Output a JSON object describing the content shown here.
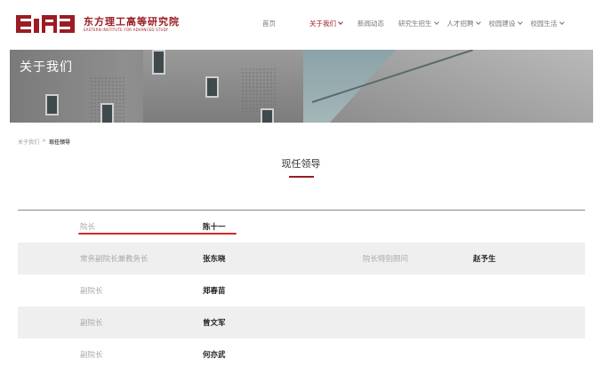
{
  "header": {
    "logo_cn": "东方理工高等研究院",
    "logo_en": "EASTERN INSTITUTE FOR ADVANCED STUDY",
    "nav": [
      {
        "label": "首页",
        "active": false,
        "has_dropdown": false
      },
      {
        "label": "关于我们",
        "active": true,
        "has_dropdown": true
      },
      {
        "label": "新闻动态",
        "active": false,
        "has_dropdown": false
      },
      {
        "label": "研究生招生",
        "active": false,
        "has_dropdown": true
      },
      {
        "label": "人才招聘",
        "active": false,
        "has_dropdown": true
      },
      {
        "label": "校园建设",
        "active": false,
        "has_dropdown": true
      },
      {
        "label": "校园生活",
        "active": false,
        "has_dropdown": true
      }
    ]
  },
  "banner": {
    "title": "关于我们"
  },
  "breadcrumb": {
    "parent": "关于我们",
    "separator": ">",
    "current": "现任领导"
  },
  "main": {
    "title": "现任领导"
  },
  "leaders": {
    "rows": [
      {
        "title": "院长",
        "name": "陈十一",
        "title2": "",
        "name2": ""
      },
      {
        "title": "常务副院长兼教务长",
        "name": "张东晓",
        "title2": "院长特别顾问",
        "name2": "赵予生"
      },
      {
        "title": "副院长",
        "name": "郑春苗",
        "title2": "",
        "name2": ""
      },
      {
        "title": "副院长",
        "name": "曾文军",
        "title2": "",
        "name2": ""
      },
      {
        "title": "副院长",
        "name": "何亦武",
        "title2": "",
        "name2": ""
      }
    ]
  },
  "colors": {
    "brand": "#9b1c24",
    "highlight_underline": "#d42a22",
    "row_shade": "#efefef"
  }
}
